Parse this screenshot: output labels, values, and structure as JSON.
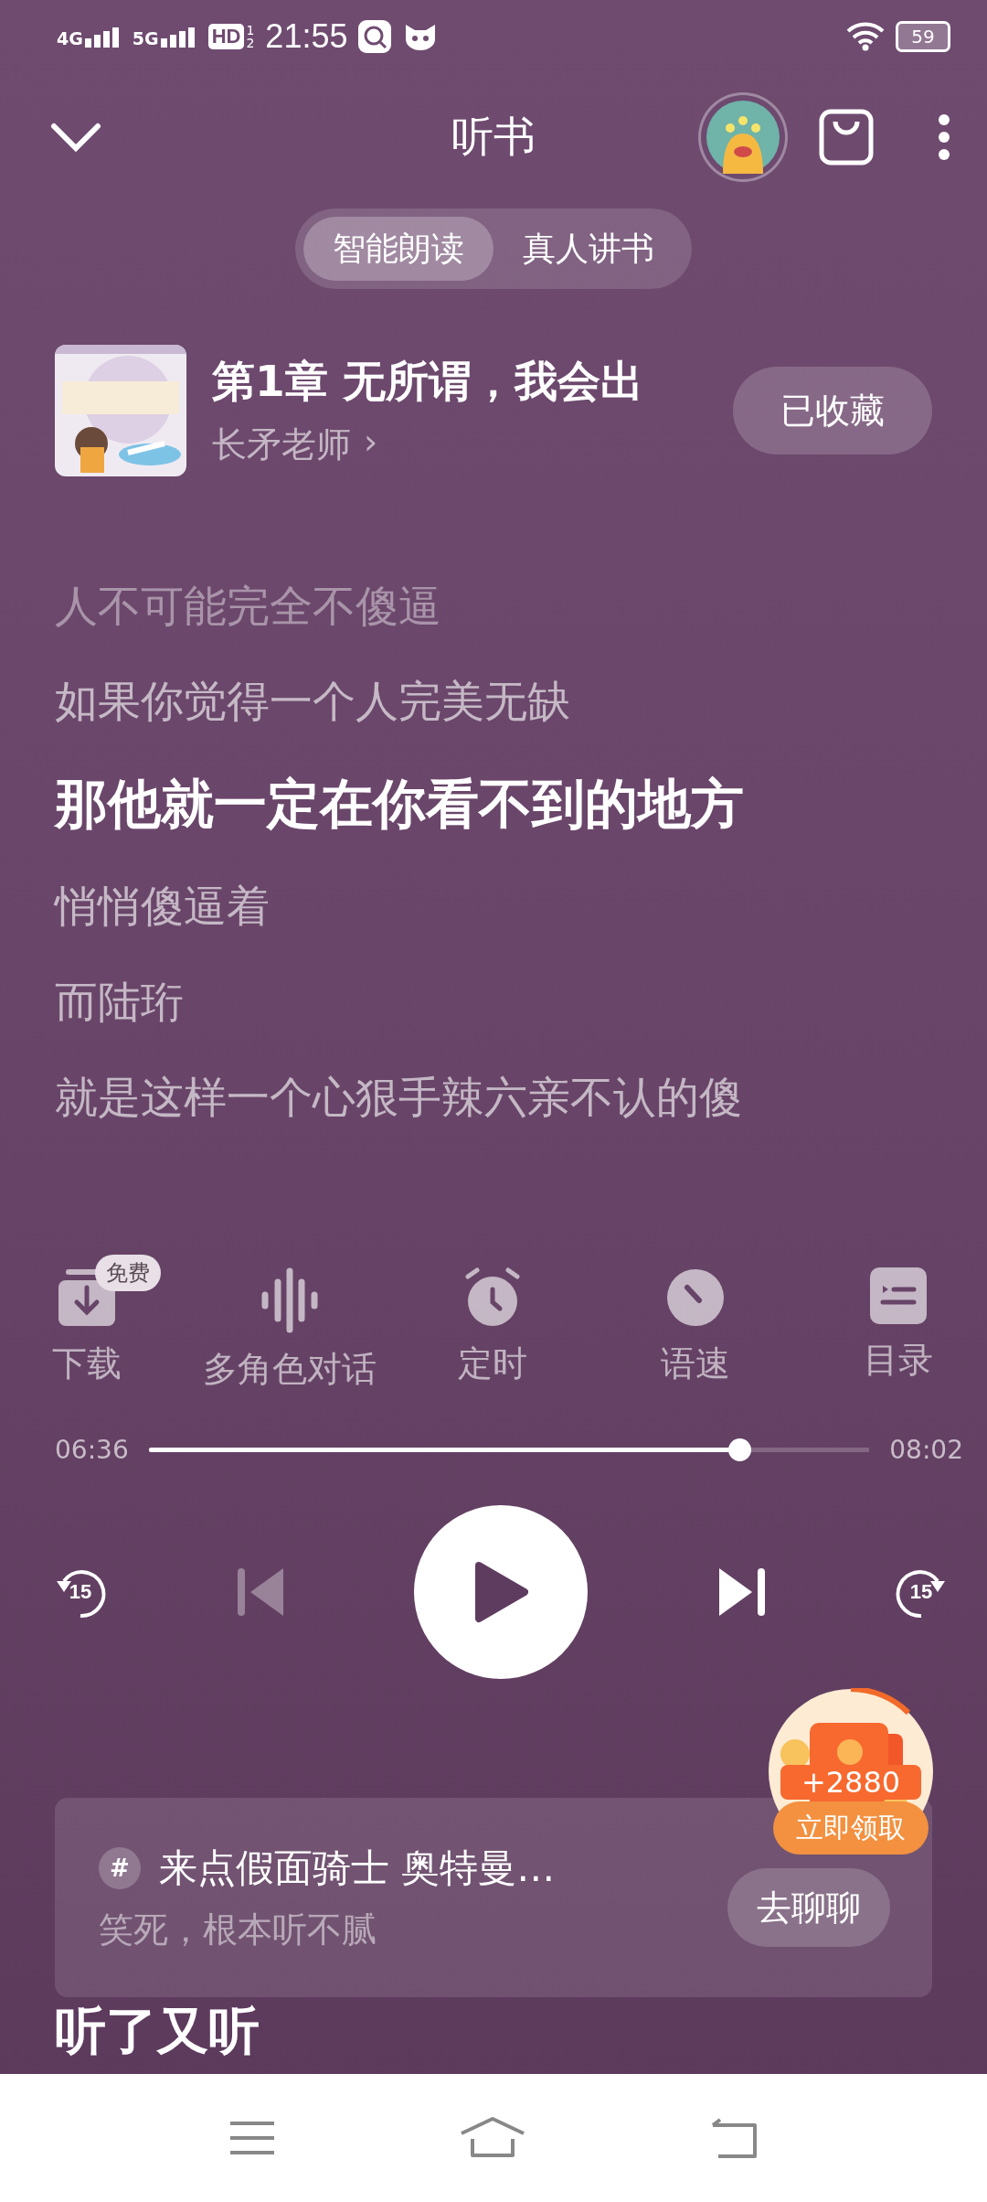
{
  "status_bar": {
    "network_1": "4G",
    "network_2": "5G",
    "hd": {
      "label": "HD",
      "sub": [
        "1",
        "2"
      ]
    },
    "time": "21:55",
    "battery": "59"
  },
  "header": {
    "title": "听书"
  },
  "tabs": [
    {
      "label": "智能朗读",
      "selected": true
    },
    {
      "label": "真人讲书",
      "selected": false
    }
  ],
  "book": {
    "title": "第1章 无所谓，我会出",
    "author": "长矛老师",
    "author_arrow": "›",
    "collect_button": "已收藏"
  },
  "lyrics": [
    {
      "text": "人不可能完全不傻逼",
      "faded": true,
      "selected": false
    },
    {
      "text": "如果你觉得一个人完美无缺",
      "faded": false,
      "selected": false
    },
    {
      "text": "那他就一定在你看不到的地方",
      "faded": false,
      "selected": true
    },
    {
      "text": "悄悄傻逼着",
      "faded": false,
      "selected": false
    },
    {
      "text": "而陆珩",
      "faded": false,
      "selected": false
    },
    {
      "text": "就是这样一个心狠手辣六亲不认的傻",
      "faded": false,
      "selected": false
    }
  ],
  "tools": [
    {
      "kind": "download",
      "label": "下载",
      "badge": "免费"
    },
    {
      "kind": "voices",
      "label": "多角色对话"
    },
    {
      "kind": "timer",
      "label": "定时"
    },
    {
      "kind": "speed",
      "label": "语速"
    },
    {
      "kind": "contents",
      "label": "目录"
    }
  ],
  "progress": {
    "elapsed": "06:36",
    "total": "08:02",
    "level": 0.82
  },
  "controls": {
    "rewind": "15",
    "forward": "15",
    "previous_disabled": true,
    "playing": false
  },
  "reward": {
    "amount": "+2880",
    "button": "立即领取"
  },
  "topic_card": {
    "hash": "#",
    "title": "来点假面骑士 奥特曼…",
    "subtitle": "笑死，根本听不腻",
    "button": "去聊聊"
  },
  "section_heading": "听了又听"
}
